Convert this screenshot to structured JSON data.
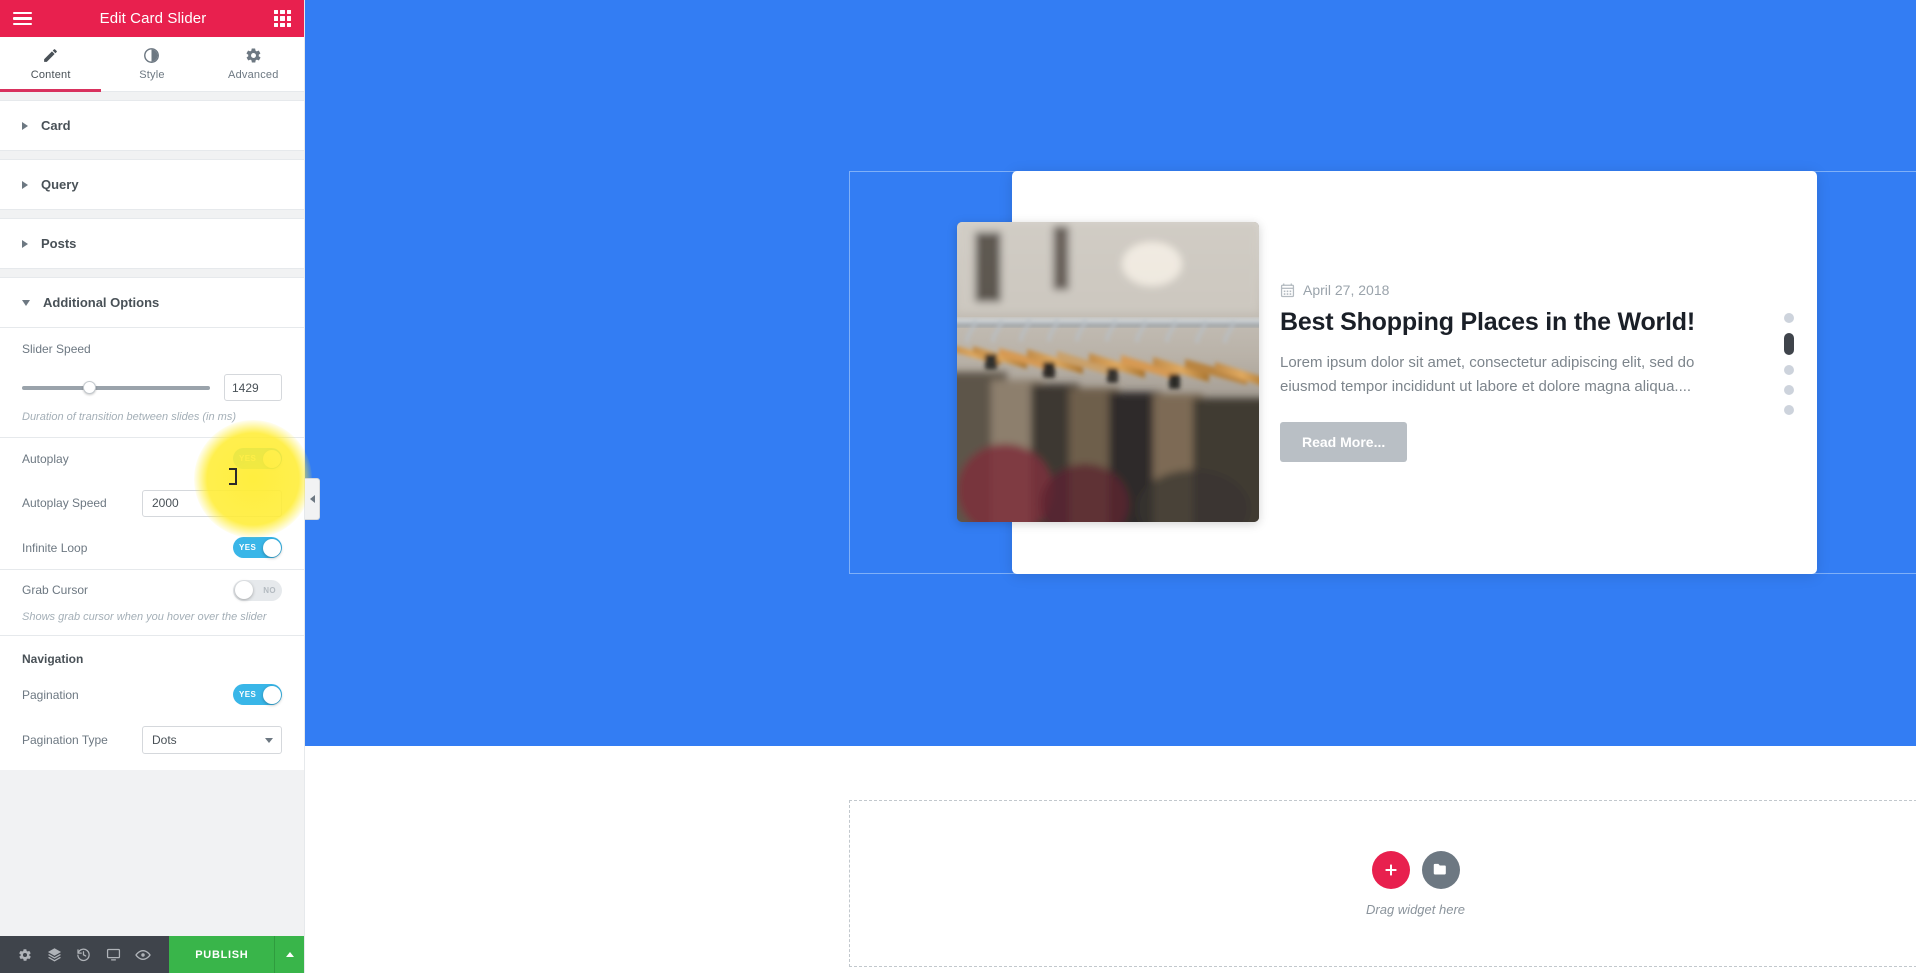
{
  "panel": {
    "header": {
      "title": "Edit Card Slider",
      "menu_icon": "hamburger-icon",
      "grid_icon": "widgets-grid-icon"
    },
    "tabs": [
      {
        "label": "Content",
        "icon": "pencil-icon",
        "active": true
      },
      {
        "label": "Style",
        "icon": "contrast-circle-icon",
        "active": false
      },
      {
        "label": "Advanced",
        "icon": "gear-icon",
        "active": false
      }
    ],
    "sections": [
      {
        "label": "Card",
        "open": false
      },
      {
        "label": "Query",
        "open": false
      },
      {
        "label": "Posts",
        "open": false
      },
      {
        "label": "Additional Options",
        "open": true
      }
    ],
    "controls": {
      "slider_speed": {
        "label": "Slider Speed",
        "value": "1429",
        "desc": "Duration of transition between slides (in ms)",
        "knob_percent": 36
      },
      "autoplay": {
        "label": "Autoplay",
        "state": "YES",
        "on": true
      },
      "autoplay_speed": {
        "label": "Autoplay Speed",
        "value": "2000"
      },
      "infinite_loop": {
        "label": "Infinite Loop",
        "state": "YES",
        "on": true
      },
      "grab_cursor": {
        "label": "Grab Cursor",
        "state": "NO",
        "on": false,
        "desc": "Shows grab cursor when you hover over the slider"
      },
      "navigation_group": "Navigation",
      "pagination": {
        "label": "Pagination",
        "state": "YES",
        "on": true
      },
      "pagination_type": {
        "label": "Pagination Type",
        "value": "Dots"
      }
    },
    "footer": {
      "icons": [
        "settings-gear-icon",
        "navigator-layers-icon",
        "history-revisions-icon",
        "responsive-mode-icon",
        "preview-eye-icon"
      ],
      "publish_label": "PUBLISH",
      "publish_caret": "chevron-up-icon"
    },
    "collapse_handle": "chevron-left-icon"
  },
  "preview": {
    "post": {
      "date": "April 27, 2018",
      "date_icon": "calendar-icon",
      "title": "Best Shopping Places in the World!",
      "excerpt": "Lorem ipsum dolor sit amet, consectetur adipiscing elit, sed do eiusmod tempor incididunt ut labore et dolore magna aliqua....",
      "read_more": "Read More...",
      "image_alt": "clothes-rack-photo"
    },
    "pagination_dots": {
      "count": 5,
      "active_index": 1
    },
    "drop_zone": {
      "label": "Drag widget here",
      "add_icon": "plus-icon",
      "template_icon": "folder-icon"
    }
  },
  "colors": {
    "brand_pink": "#e8204e",
    "section_blue": "#337df3",
    "toggle_on": "#39b6e8",
    "publish_green": "#39b54a",
    "tab_underline": "#d9325e"
  }
}
